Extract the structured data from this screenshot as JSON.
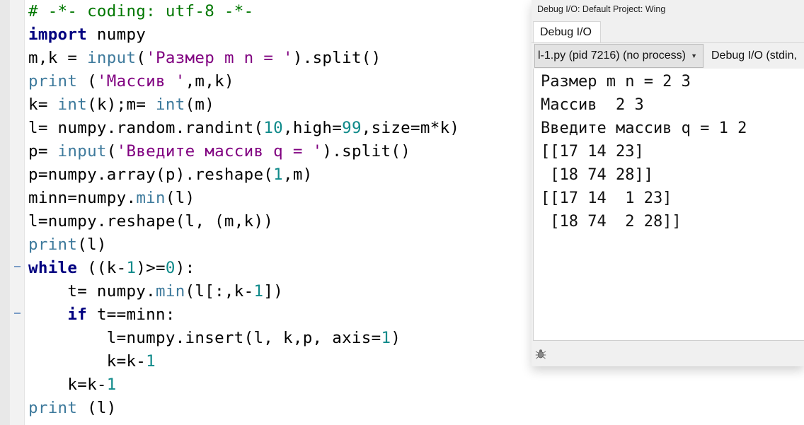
{
  "editor": {
    "lines": [
      [
        {
          "t": "# -*- coding: utf-8 -*-",
          "c": "com"
        }
      ],
      [
        {
          "t": "import",
          "c": "kw"
        },
        {
          "t": " numpy",
          "c": "def"
        }
      ],
      [
        {
          "t": "m,k = ",
          "c": "def"
        },
        {
          "t": "input",
          "c": "bi"
        },
        {
          "t": "(",
          "c": "def"
        },
        {
          "t": "'Размер m n = '",
          "c": "str"
        },
        {
          "t": ").split()",
          "c": "def"
        }
      ],
      [
        {
          "t": "print",
          "c": "bi"
        },
        {
          "t": " (",
          "c": "def"
        },
        {
          "t": "'Массив '",
          "c": "str"
        },
        {
          "t": ",m,k)",
          "c": "def"
        }
      ],
      [
        {
          "t": "k= ",
          "c": "def"
        },
        {
          "t": "int",
          "c": "bi"
        },
        {
          "t": "(k);m= ",
          "c": "def"
        },
        {
          "t": "int",
          "c": "bi"
        },
        {
          "t": "(m)",
          "c": "def"
        }
      ],
      [
        {
          "t": "l= numpy.random.randint(",
          "c": "def"
        },
        {
          "t": "10",
          "c": "num"
        },
        {
          "t": ",high=",
          "c": "def"
        },
        {
          "t": "99",
          "c": "num"
        },
        {
          "t": ",size=m*k)",
          "c": "def"
        }
      ],
      [
        {
          "t": "p= ",
          "c": "def"
        },
        {
          "t": "input",
          "c": "bi"
        },
        {
          "t": "(",
          "c": "def"
        },
        {
          "t": "'Введите массив q = '",
          "c": "str"
        },
        {
          "t": ").split()",
          "c": "def"
        }
      ],
      [
        {
          "t": "p=numpy.array(p).reshape(",
          "c": "def"
        },
        {
          "t": "1",
          "c": "num"
        },
        {
          "t": ",m)",
          "c": "def"
        }
      ],
      [
        {
          "t": "minn=numpy.",
          "c": "def"
        },
        {
          "t": "min",
          "c": "bi"
        },
        {
          "t": "(l)",
          "c": "def"
        }
      ],
      [
        {
          "t": "l=numpy.reshape(l, (m,k))",
          "c": "def"
        }
      ],
      [
        {
          "t": "print",
          "c": "bi"
        },
        {
          "t": "(l)",
          "c": "def"
        }
      ],
      [
        {
          "t": "while",
          "c": "kw"
        },
        {
          "t": " ((k-",
          "c": "def"
        },
        {
          "t": "1",
          "c": "num"
        },
        {
          "t": ")>=",
          "c": "def"
        },
        {
          "t": "0",
          "c": "num"
        },
        {
          "t": "):",
          "c": "def"
        }
      ],
      [
        {
          "t": "    t= numpy.",
          "c": "def"
        },
        {
          "t": "min",
          "c": "bi"
        },
        {
          "t": "(l[:,k-",
          "c": "def"
        },
        {
          "t": "1",
          "c": "num"
        },
        {
          "t": "])",
          "c": "def"
        }
      ],
      [
        {
          "t": "    ",
          "c": "def"
        },
        {
          "t": "if",
          "c": "kw"
        },
        {
          "t": " t==minn:",
          "c": "def"
        }
      ],
      [
        {
          "t": "        l=numpy.insert(l, k,p, axis=",
          "c": "def"
        },
        {
          "t": "1",
          "c": "num"
        },
        {
          "t": ")",
          "c": "def"
        }
      ],
      [
        {
          "t": "        k=k-",
          "c": "def"
        },
        {
          "t": "1",
          "c": "num"
        }
      ],
      [
        {
          "t": "    k=k-",
          "c": "def"
        },
        {
          "t": "1",
          "c": "num"
        }
      ],
      [
        {
          "t": "print",
          "c": "bi"
        },
        {
          "t": " (l)",
          "c": "def"
        }
      ]
    ],
    "fold_markers": [
      "while-block",
      "if-block"
    ]
  },
  "debug_panel": {
    "title": "Debug I/O: Default Project: Wing",
    "tab": "Debug I/O",
    "process_select": "l-1.py (pid 7216) (no process)",
    "stream_label": "Debug I/O (stdin,",
    "output": [
      "Размер m n = 2 3",
      "Массив  2 3",
      "Введите массив q = 1 2",
      "[[17 14 23]",
      " [18 74 28]]",
      "[[17 14  1 23]",
      " [18 74  2 28]]"
    ],
    "status_icon": "bug-icon"
  }
}
